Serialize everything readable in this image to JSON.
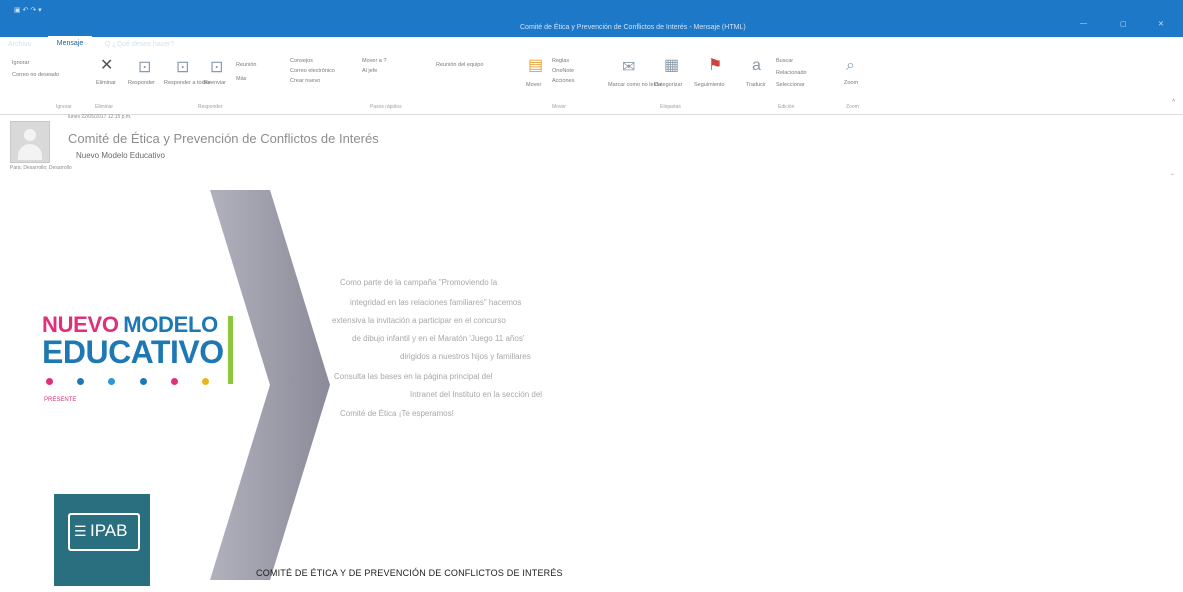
{
  "window": {
    "title": "Comité de Ética y Prevención de Conflictos de Interés - Mensaje (HTML)"
  },
  "tabs": [
    "Archivo",
    "Mensaje",
    "Q ¿Qué desea hacer?"
  ],
  "ribbon": {
    "groups": {
      "ignorar": {
        "label": "Ignorar",
        "items": [
          "Ignorar",
          "Correo no deseado"
        ]
      },
      "eliminar": {
        "label": "Eliminar",
        "items": [
          "Eliminar"
        ]
      },
      "responder": {
        "label": "Responder",
        "items": [
          "Responder",
          "Responder a todos",
          "Reenviar",
          "Reunión",
          "Más"
        ]
      },
      "pasos_rapidos": {
        "label": "Pasos rápidos",
        "items": [
          "Consejos",
          "Correo electrónico",
          "Crear nuevo",
          "Mover a ?",
          "Al jefe",
          "Reunión del equipo"
        ]
      },
      "mover": {
        "label": "Mover",
        "items": [
          "Mover",
          "Reglas",
          "OneNote",
          "Acciones"
        ]
      },
      "etiquetas": {
        "label": "Etiquetas",
        "items": [
          "Marcar como no leído",
          "Categorizar",
          "Seguimiento"
        ]
      },
      "edicion": {
        "label": "Edición",
        "items": [
          "Traducir",
          "Buscar",
          "Relacionado",
          "Seleccionar"
        ]
      },
      "zoom": {
        "label": "Zoom",
        "items": [
          "Zoom"
        ]
      }
    }
  },
  "header": {
    "date": "lunes 22/05/2017 12:15 p.m.",
    "subject": "Comité de Ética y Prevención de Conflictos de Interés",
    "sender": "Nuevo Modelo Educativo",
    "to_line": "Para:   Desarrollo;   Desarrollo"
  },
  "body": {
    "logo": {
      "word1": "NUEVO",
      "word2": "MODELO",
      "word3": "EDUCATIVO",
      "tagline": "PRESENTE"
    },
    "message_lines": [
      "Como parte de la campaña \"Promoviendo la",
      "integridad en las relaciones familiares\" hacemos",
      "extensiva la invitación a participar en el concurso",
      "de dibujo infantil y en el Maratón 'Juego 11 años'",
      "dirigidos a nuestros hijos y familiares",
      "Consulta las bases en la página principal del",
      "Intranet del Instituto en la sección del",
      "Comité de Ética ¡Te esperamos!",
      "",
      ""
    ],
    "ipab_text": "IPAB",
    "footer": "COMITÉ DE ÉTICA Y DE PREVENCIÓN DE CONFLICTOS DE INTERÉS"
  },
  "colors": {
    "title_bar": "#1e78c8",
    "logo_pink": "#e0307a",
    "logo_blue": "#1e78b4",
    "logo_green": "#8cc63f",
    "ipab_teal": "#2a6f80",
    "chevron_gray": "#8c8c9c"
  }
}
